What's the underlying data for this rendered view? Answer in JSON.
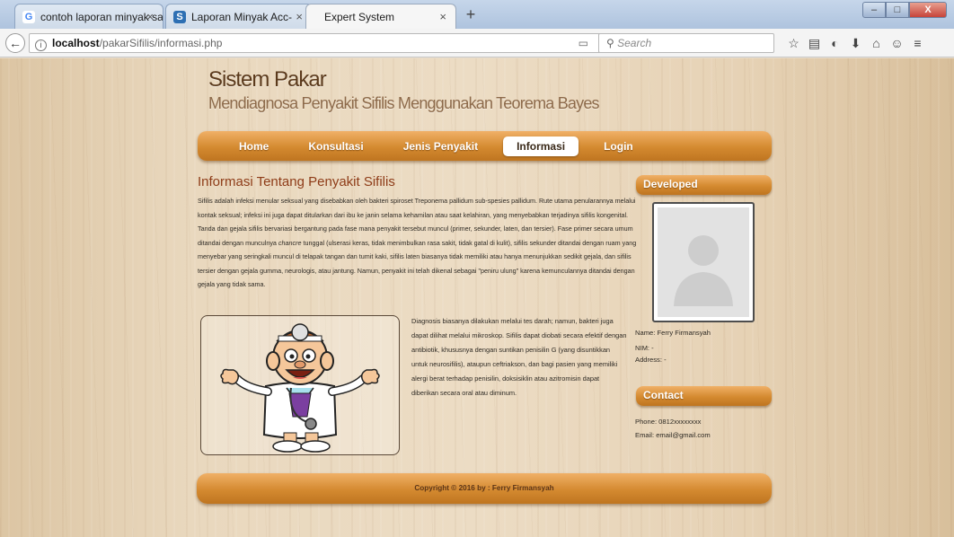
{
  "browser": {
    "tabs": [
      {
        "title": "contoh laporan minyak sa...",
        "favicon": "G"
      },
      {
        "title": "Laporan Minyak Acc-",
        "favicon": "S"
      },
      {
        "title": "Expert System",
        "favicon": ""
      }
    ],
    "url_host": "localhost",
    "url_path": "/pakarSifilis/informasi.php",
    "search_placeholder": "Search"
  },
  "header": {
    "title": "Sistem Pakar",
    "subtitle": "Mendiagnosa Penyakit Sifilis Menggunakan Teorema Bayes"
  },
  "menu": {
    "items": [
      "Home",
      "Konsultasi",
      "Jenis Penyakit",
      "Informasi",
      "Login"
    ],
    "active": "Informasi"
  },
  "content": {
    "title": "Informasi Tentang Penyakit Sifilis",
    "para_a": "Sifilis adalah infeksi menular seksual yang disebabkan oleh bakteri spiroset Treponema pallidum sub-spesies pallidum. Rute utama penularannya melalui kontak seksual; infeksi ini juga dapat ditularkan dari ibu ke janin selama kehamilan atau saat kelahiran, yang menyebabkan terjadinya sifilis kongenital. Tanda dan gejala sifilis bervariasi bergantung pada fase mana penyakit tersebut muncul (primer, sekunder, laten, dan tersier). Fase primer secara umum ditandai dengan munculnya ",
    "para_italic": "chancre",
    "para_b": " tunggal (ulserasi keras, tidak menimbulkan rasa sakit, tidak gatal di kulit), sifilis sekunder ditandai dengan ruam yang menyebar yang seringkali muncul di telapak tangan dan tumit kaki, sifilis laten biasanya tidak memiliki atau hanya menunjukkan sedikit gejala, dan sifilis tersier dengan gejala gumma, neurologis, atau jantung. Namun, penyakit ini telah dikenal sebagai \"peniru ulung\" karena kemunculannya ditandai dengan gejala yang tidak sama.",
    "side_paragraph": "Diagnosis biasanya dilakukan melalui tes darah; namun, bakteri juga dapat dilihat melalui mikroskop. Sifilis dapat diobati secara efektif dengan antibiotik, khususnya dengan suntikan penisilin G (yang disuntikkan untuk neurosifilis), ataupun ceftriakson, dan bagi pasien yang memiliki alergi berat terhadap penisilin, doksisiklin atau azitromisin dapat diberikan secara oral atau diminum."
  },
  "sidebar": {
    "developed_title": "Developed",
    "name_line": "Name: Ferry Firmansyah",
    "nim_line": "NIM: -",
    "address_line": "Address: -",
    "contact_title": "Contact",
    "phone_line": "Phone: 0812xxxxxxxx",
    "email_line": "Email: email@gmail.com"
  },
  "footer": {
    "copyright": "Copyright © 2016 by : Ferry Firmansyah"
  },
  "colors": {
    "menu_orange": "#d48a30",
    "title_red": "#8e3c18",
    "heading_brown": "#5b3a1c"
  }
}
